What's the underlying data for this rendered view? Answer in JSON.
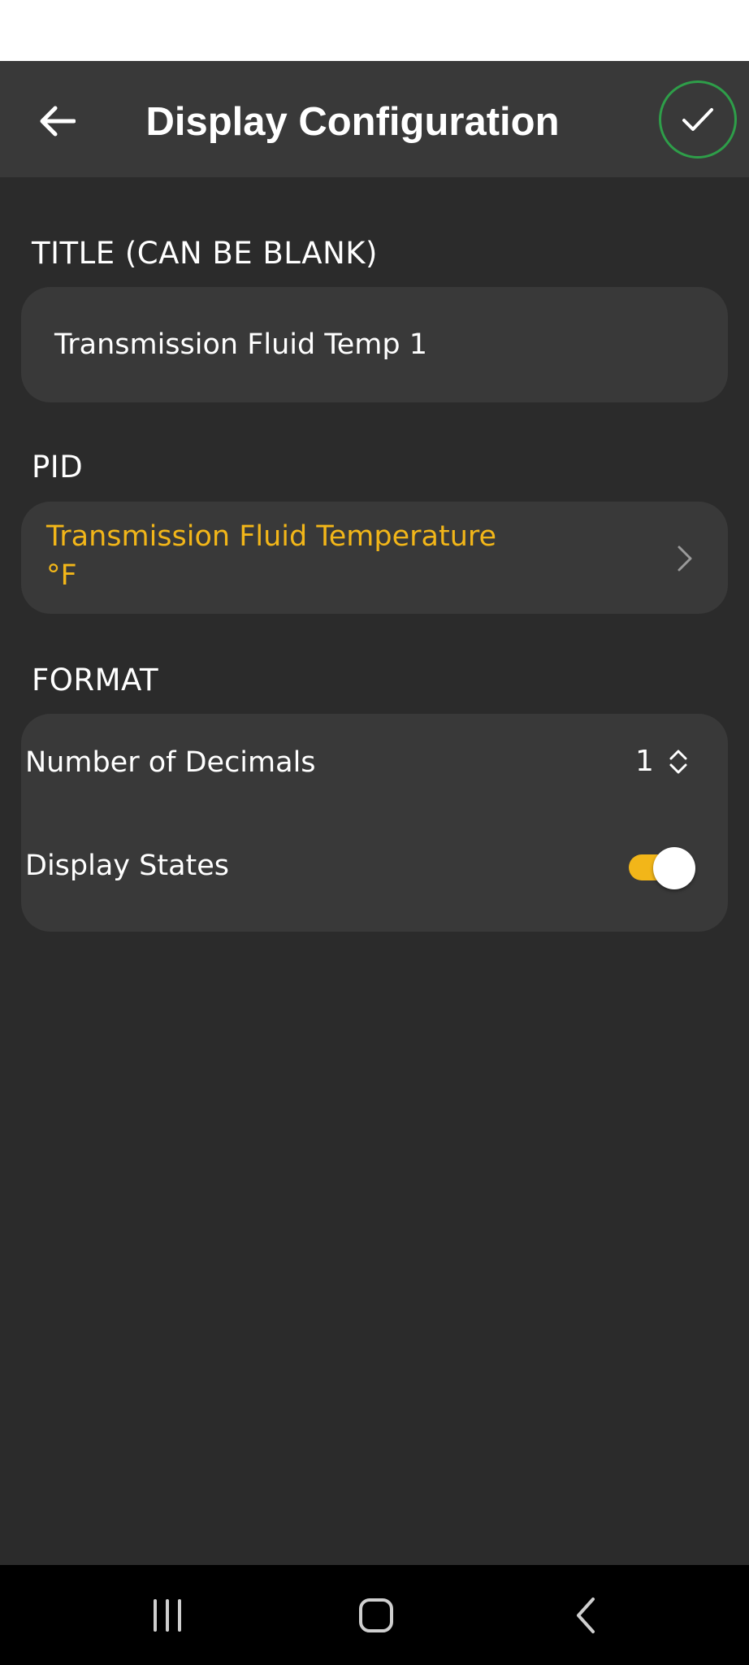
{
  "header": {
    "title": "Display Configuration",
    "back_icon": "arrow-left-icon",
    "confirm_icon": "checkmark-icon"
  },
  "title_section": {
    "label": "TITLE (CAN BE BLANK)",
    "value": "Transmission Fluid Temp 1"
  },
  "pid_section": {
    "label": "PID",
    "name": "Transmission Fluid Temperature",
    "unit": "°F",
    "chevron_icon": "chevron-right-icon"
  },
  "format_section": {
    "label": "FORMAT",
    "decimals_label": "Number of Decimals",
    "decimals_value": "1",
    "display_states_label": "Display States",
    "display_states_on": true
  },
  "colors": {
    "accent": "#f2b619",
    "confirm_ring": "#2e9e49",
    "background": "#2b2b2b",
    "card": "#393939"
  },
  "nav": {
    "recents_icon": "recents-icon",
    "home_icon": "home-icon",
    "back_icon": "system-back-icon"
  }
}
